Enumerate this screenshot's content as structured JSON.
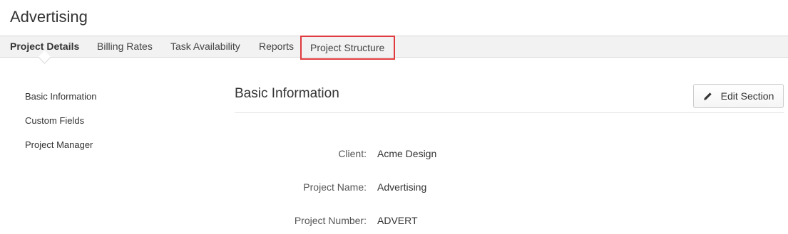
{
  "page": {
    "title": "Advertising"
  },
  "tabs": [
    {
      "label": "Project Details",
      "active": true
    },
    {
      "label": "Billing Rates",
      "active": false
    },
    {
      "label": "Task Availability",
      "active": false
    },
    {
      "label": "Reports",
      "active": false
    },
    {
      "label": "Project Structure",
      "active": false,
      "highlighted": true
    }
  ],
  "sidebar": {
    "items": [
      {
        "label": "Basic Information"
      },
      {
        "label": "Custom Fields"
      },
      {
        "label": "Project Manager"
      }
    ]
  },
  "section": {
    "title": "Basic Information",
    "edit_button": {
      "label": "Edit Section",
      "icon": "pencil-icon"
    }
  },
  "fields": [
    {
      "label": "Client:",
      "value": "Acme Design"
    },
    {
      "label": "Project Name:",
      "value": "Advertising"
    },
    {
      "label": "Project Number:",
      "value": "ADVERT"
    }
  ],
  "colors": {
    "highlight_border": "#e0393e",
    "tabbar_bg": "#f2f2f2"
  }
}
